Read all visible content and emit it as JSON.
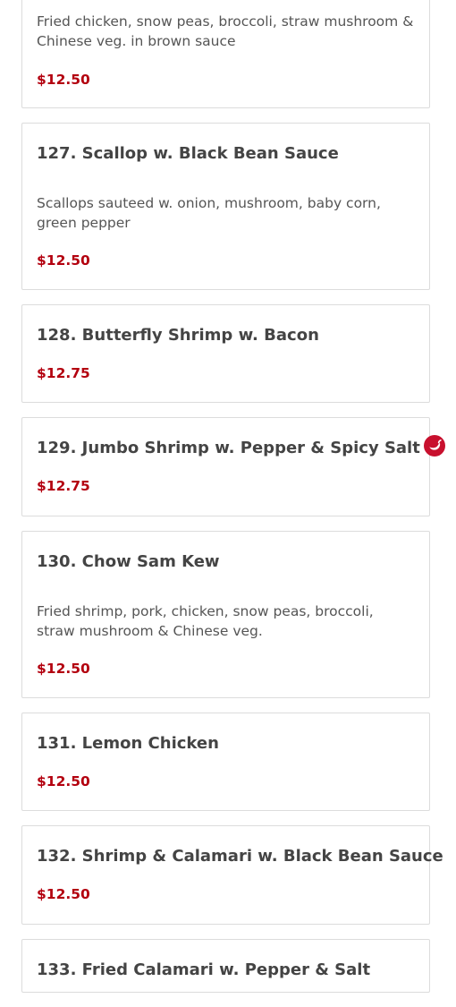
{
  "menu_items": [
    {
      "title": "",
      "description": "Fried chicken, snow peas, broccoli, straw mushroom & Chinese veg. in brown sauce",
      "price": "$12.50",
      "spicy": false
    },
    {
      "title": "127. Scallop w. Black Bean Sauce",
      "description": "Scallops sauteed w. onion, mushroom, baby corn, green pepper",
      "price": "$12.50",
      "spicy": false
    },
    {
      "title": "128. Butterfly Shrimp w. Bacon",
      "description": "",
      "price": "$12.75",
      "spicy": false
    },
    {
      "title": "129. Jumbo Shrimp w. Pepper & Spicy Salt",
      "description": "",
      "price": "$12.75",
      "spicy": true
    },
    {
      "title": "130. Chow Sam Kew",
      "description": "Fried shrimp, pork, chicken, snow peas, broccoli, straw mushroom & Chinese veg.",
      "price": "$12.50",
      "spicy": false
    },
    {
      "title": "131. Lemon Chicken",
      "description": "",
      "price": "$12.50",
      "spicy": false
    },
    {
      "title": "132. Shrimp & Calamari w. Black Bean Sauce",
      "description": "",
      "price": "$12.50",
      "spicy": false
    },
    {
      "title": "133. Fried Calamari w. Pepper & Salt",
      "description": "",
      "price": "",
      "spicy": false
    }
  ],
  "icons": {
    "spicy": "chili-pepper-icon"
  },
  "colors": {
    "price": "#b3000f",
    "spicy_icon": "#c8102e",
    "card_border": "#dcdcdc",
    "title_text": "#444444"
  }
}
